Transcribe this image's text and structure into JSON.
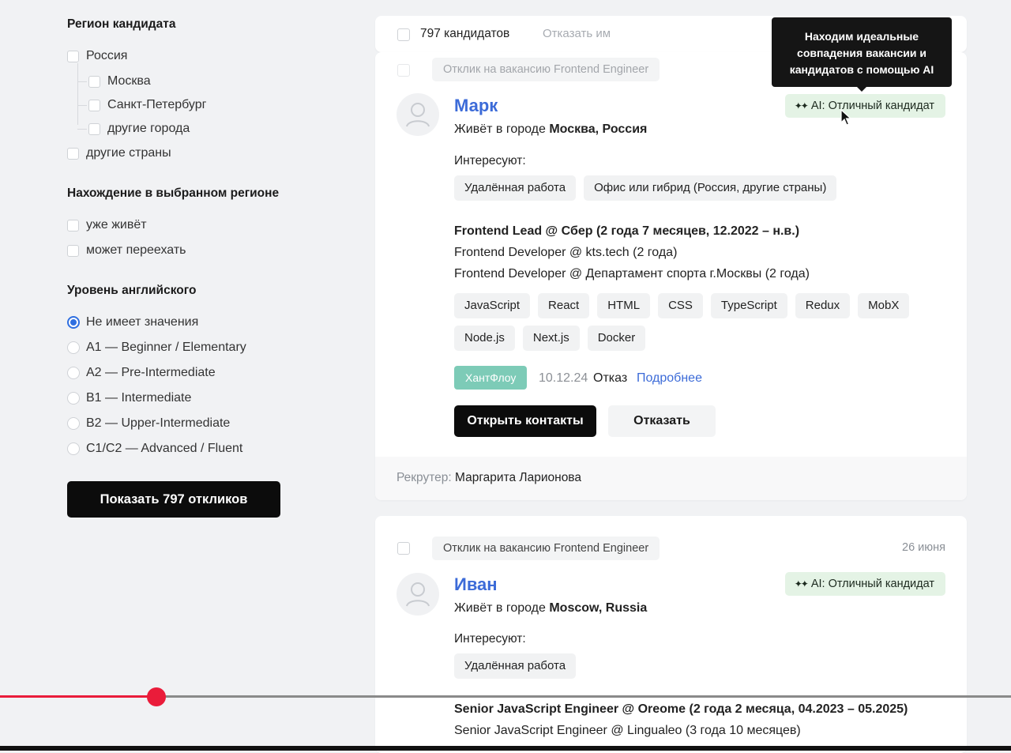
{
  "filters": {
    "region": {
      "title": "Регион кандидата",
      "options": [
        "Россия",
        "Москва",
        "Санкт-Петербург",
        "другие города",
        "другие страны"
      ]
    },
    "presence": {
      "title": "Нахождение в выбранном регионе",
      "options": [
        "уже живёт",
        "может переехать"
      ]
    },
    "english": {
      "title": "Уровень английского",
      "options": [
        "Не имеет значения",
        "A1 — Beginner / Elementary",
        "A2 — Pre-Intermediate",
        "B1 — Intermediate",
        "B2 — Upper-Intermediate",
        "C1/C2 — Advanced / Fluent"
      ],
      "selected": "Не имеет значения"
    },
    "show_button": "Показать 797 откликов"
  },
  "toolbar": {
    "count_label": "797 кандидатов",
    "reject_all": "Отказать им"
  },
  "tooltip": {
    "lines": [
      "Находим идеальные",
      "совпадения вакансии и",
      "кандидатов с помощью AI"
    ]
  },
  "candidates": [
    {
      "vacancy_tag": "Отклик на вакансию Frontend Engineer",
      "name": "Марк",
      "location_prefix": "Живёт в городе ",
      "location": "Москва, Россия",
      "ai_badge": "AI: Отличный кандидат",
      "interests_label": "Интересуют:",
      "interests": [
        "Удалённая работа",
        "Офис или гибрид (Россия, другие страны)"
      ],
      "experience": [
        "Frontend Lead @ Сбер (2 года 7 месяцев, 12.2022 – н.в.)",
        "Frontend Developer @ kts.tech (2 года)",
        "Frontend Developer @ Департамент спорта г.Москвы (2 года)"
      ],
      "skills": [
        "JavaScript",
        "React",
        "HTML",
        "CSS",
        "TypeScript",
        "Redux",
        "MobX",
        "Node.js",
        "Next.js",
        "Docker"
      ],
      "history": {
        "source": "ХантФлоу",
        "date": "10.12.24",
        "status": "Отказ",
        "link": "Подробнее"
      },
      "open_contacts": "Открыть контакты",
      "reject": "Отказать",
      "recruiter_label": "Рекрутер: ",
      "recruiter": "Маргарита Ларионова"
    },
    {
      "vacancy_tag": "Отклик на вакансию Frontend Engineer",
      "date": "26 июня",
      "name": "Иван",
      "location_prefix": "Живёт в городе ",
      "location": "Moscow, Russia",
      "ai_badge": "AI: Отличный кандидат",
      "interests_label": "Интересуют:",
      "interests": [
        "Удалённая работа"
      ],
      "experience": [
        "Senior JavaScript Engineer @ Oreome (2 года 2 месяца, 04.2023 – 05.2025)",
        "Senior JavaScript Engineer @ Lingualeo (3 года 10 месяцев)"
      ]
    }
  ],
  "video": {
    "progress": 0.155
  },
  "colors": {
    "accent_link": "#3c6bd8",
    "ai_badge_bg": "#e4f3e5",
    "huntflow_badge": "#7dcbb7",
    "progress_red": "#ea1c3a",
    "primary_button": "#0c0c0c"
  }
}
